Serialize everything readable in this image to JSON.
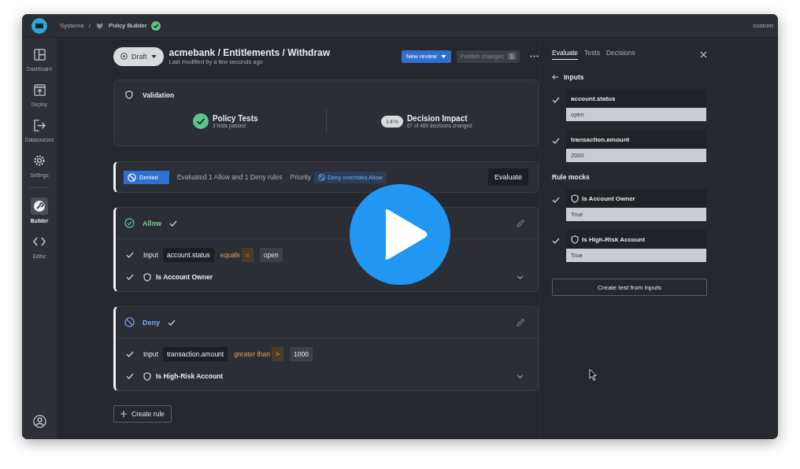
{
  "topbar": {
    "separator": "/",
    "breadcrumb": [
      {
        "label": "Systems"
      },
      {
        "label": "Policy Builder",
        "verified": true
      }
    ],
    "workspace": "custom"
  },
  "sidebar": {
    "items": [
      {
        "label": "Dashboard",
        "selected": false
      },
      {
        "label": "Deploy",
        "selected": false
      },
      {
        "label": "Datasources",
        "selected": false
      },
      {
        "label": "Settings",
        "selected": false
      },
      {
        "label": "Builder",
        "selected": true
      },
      {
        "label": "Editor",
        "selected": false
      }
    ]
  },
  "header": {
    "status": "Draft",
    "title": "acmebank / Entitlements / Withdraw",
    "subtitle": "Last modified by a few seconds ago",
    "new_review": "New review",
    "publish": {
      "label": "Publish changes",
      "count": "1",
      "disabled": true
    }
  },
  "validation": {
    "title": "Validation",
    "metrics": [
      {
        "kind": "check",
        "title": "Policy Tests",
        "detail": "3 tests passed"
      },
      {
        "kind": "percent",
        "badge": "14%",
        "title": "Decision Impact",
        "detail": "67 of 469 decisions changed"
      }
    ]
  },
  "evaluation": {
    "result": "Denied",
    "summary": "Evaluated 1 Allow and 1 Deny rules",
    "priority_label": "Priority",
    "priority": "Deny overrides Allow",
    "button": "Evaluate"
  },
  "rules": [
    {
      "kind": "allow",
      "label": "Allow",
      "passed": true,
      "conditions": [
        {
          "kind": "input",
          "passed": true,
          "prefix": "Input",
          "field": "account.status",
          "operator": "equals",
          "symbol": "=",
          "value": "open"
        },
        {
          "kind": "rule",
          "passed": true,
          "name": "Is Account Owner"
        }
      ]
    },
    {
      "kind": "deny",
      "label": "Deny",
      "passed": true,
      "conditions": [
        {
          "kind": "input",
          "passed": true,
          "prefix": "Input",
          "field": "transaction.amount",
          "operator": "greater than",
          "symbol": ">",
          "value": "1000"
        },
        {
          "kind": "rule",
          "passed": true,
          "name": "Is High-Risk Account"
        }
      ]
    }
  ],
  "create_rule": "Create rule",
  "panel": {
    "tabs": [
      {
        "label": "Evaluate",
        "selected": true
      },
      {
        "label": "Tests",
        "selected": false
      },
      {
        "label": "Decisions",
        "selected": false
      }
    ],
    "inputs_title": "Inputs",
    "inputs": [
      {
        "checked": true,
        "name": "account.status",
        "value": "open"
      },
      {
        "checked": true,
        "name": "transaction.amount",
        "value": "2000"
      }
    ],
    "mocks_title": "Rule mocks",
    "mocks": [
      {
        "checked": true,
        "name": "Is Account Owner",
        "value": "True"
      },
      {
        "checked": true,
        "name": "Is High-Risk Account",
        "value": "True"
      }
    ],
    "create_test": "Create test from inputs"
  }
}
